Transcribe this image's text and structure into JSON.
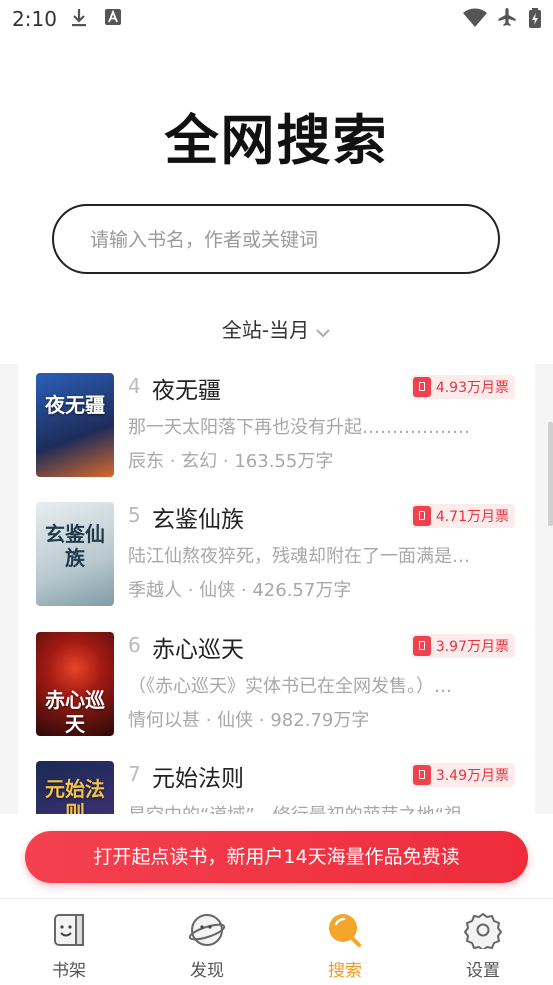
{
  "status_bar": {
    "time": "2:10"
  },
  "header": {
    "title": "全网搜索"
  },
  "search": {
    "placeholder": "请输入书名，作者或关键词"
  },
  "filter": {
    "label": "全站-当月"
  },
  "books": [
    {
      "rank": "4",
      "name": "夜无疆",
      "tickets": "4.93万月票",
      "desc": "那一天太阳落下再也没有升起………………",
      "author": "辰东",
      "genre": "玄幻",
      "words": "163.55万字",
      "cover_text": "夜无疆",
      "cover_bg": "#1d3b7a"
    },
    {
      "rank": "5",
      "name": "玄鉴仙族",
      "tickets": "4.71万月票",
      "desc": "陆江仙熬夜猝死，残魂却附在了一面满是…",
      "author": "季越人",
      "genre": "仙侠",
      "words": "426.57万字",
      "cover_text": "玄鉴仙族",
      "cover_bg": "#cfd9de"
    },
    {
      "rank": "6",
      "name": "赤心巡天",
      "tickets": "3.97万月票",
      "desc": "（《赤心巡天》实体书已在全网发售。）…",
      "author": "情何以甚",
      "genre": "仙侠",
      "words": "982.79万字",
      "cover_text": "赤心巡天",
      "cover_bg": "#7a1212"
    },
    {
      "rank": "7",
      "name": "元始法则",
      "tickets": "3.49万月票",
      "desc": "星空中的“道域”，修行最初的萌芽之地“祖…",
      "author": "",
      "genre": "",
      "words": "",
      "cover_text": "元始法则",
      "cover_bg": "#1a2a55"
    }
  ],
  "cta": {
    "label": "打开起点读书，新用户14天海量作品免费读"
  },
  "tabs": [
    {
      "label": "书架",
      "icon": "bookshelf-icon"
    },
    {
      "label": "发现",
      "icon": "discover-icon"
    },
    {
      "label": "搜索",
      "icon": "search-icon"
    },
    {
      "label": "设置",
      "icon": "gear-icon"
    }
  ],
  "colors": {
    "accent": "#f39a1a",
    "cta": "#f0414f",
    "ticket": "#e8333f"
  }
}
